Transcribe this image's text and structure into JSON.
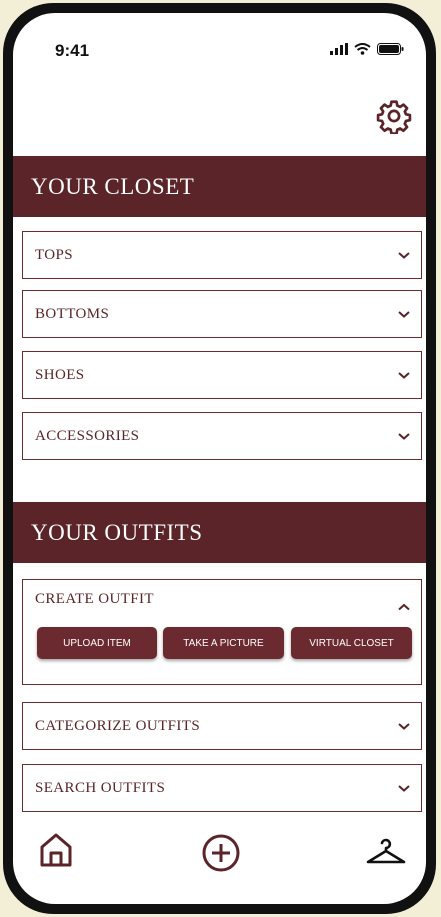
{
  "status": {
    "time": "9:41"
  },
  "closet": {
    "title": "YOUR CLOSET",
    "items": [
      {
        "label": "TOPS"
      },
      {
        "label": "BOTTOMS"
      },
      {
        "label": "SHOES"
      },
      {
        "label": "ACCESSORIES"
      }
    ]
  },
  "outfits": {
    "title": "YOUR OUTFITS",
    "create": {
      "label": "CREATE OUTFIT",
      "buttons": [
        "UPLOAD ITEM",
        "TAKE A PICTURE",
        "VIRTUAL CLOSET"
      ]
    },
    "items": [
      {
        "label": "CATEGORIZE OUTFITS"
      },
      {
        "label": "SEARCH OUTFITS"
      }
    ]
  },
  "nav": {
    "icons": [
      "home-icon",
      "add-circle-icon",
      "hanger-icon"
    ]
  },
  "colors": {
    "accent": "#5a2428",
    "border": "#6b2a30",
    "background": "#f3efd6"
  },
  "settings": {
    "icon": "gear-icon"
  }
}
